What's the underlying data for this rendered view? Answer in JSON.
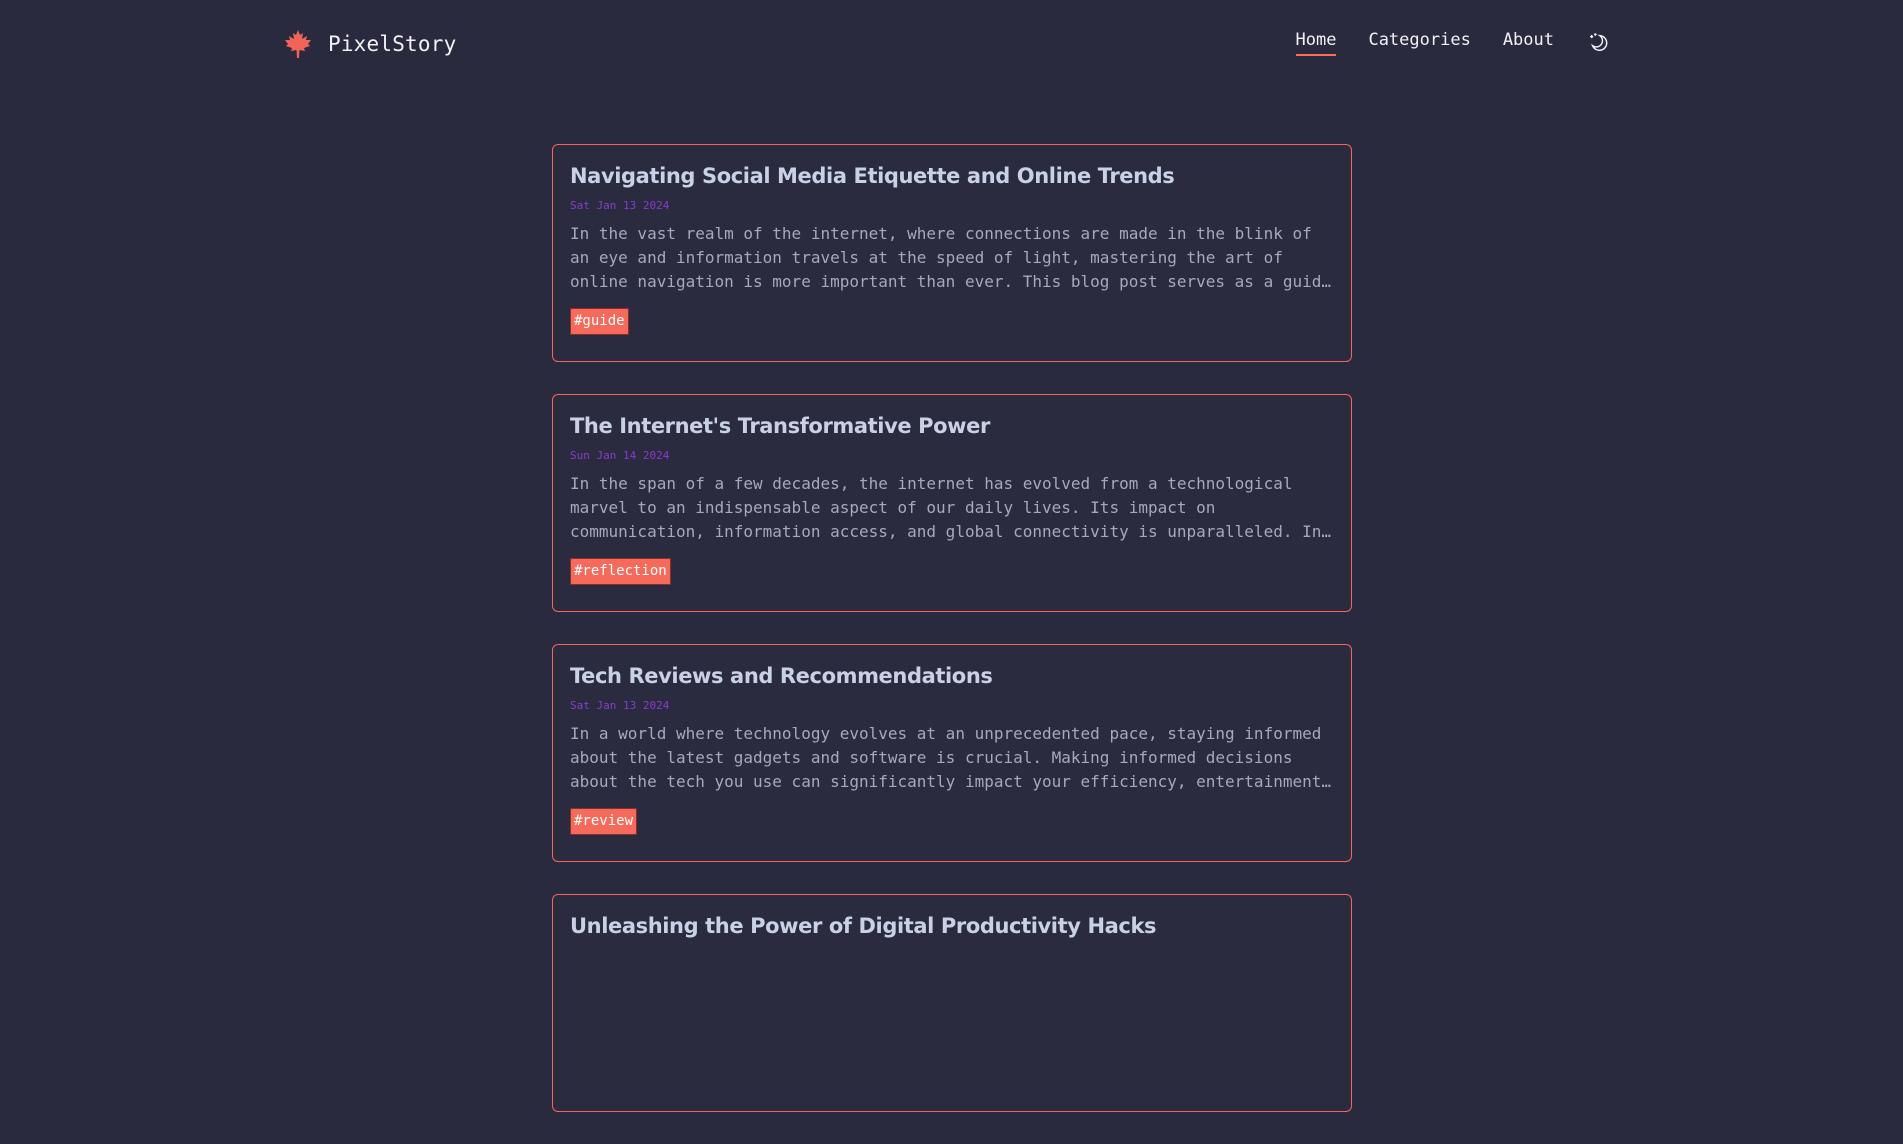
{
  "site": {
    "name": "PixelStory",
    "logo_icon": "maple-leaf-icon",
    "accent_color": "#ff6b55"
  },
  "nav": {
    "items": [
      {
        "label": "Home",
        "active": true
      },
      {
        "label": "Categories",
        "active": false
      },
      {
        "label": "About",
        "active": false
      }
    ],
    "theme_toggle_icon": "theme-toggle-icon"
  },
  "posts": [
    {
      "title": "Navigating Social Media Etiquette and Online Trends",
      "date": "Sat Jan 13 2024",
      "excerpt": "In the vast realm of the internet, where connections are made in the blink of an eye and information travels at the speed of light, mastering the art of online navigation is more important than ever. This blog post serves as a guide to the unwritten rules of the digital world.",
      "tag": "#guide"
    },
    {
      "title": "The Internet's Transformative Power",
      "date": "Sun Jan 14 2024",
      "excerpt": "In the span of a few decades, the internet has evolved from a technological marvel to an indispensable aspect of our daily lives. Its impact on communication, information access, and global connectivity is unparalleled. In this post we reflect on that journey.",
      "tag": "#reflection"
    },
    {
      "title": "Tech Reviews and Recommendations",
      "date": "Sat Jan 13 2024",
      "excerpt": "In a world where technology evolves at an unprecedented pace, staying informed about the latest gadgets and software is crucial. Making informed decisions about the tech you use can significantly impact your efficiency, entertainment and overall experience.",
      "tag": "#review"
    },
    {
      "title": "Unleashing the Power of Digital Productivity Hacks",
      "date": "",
      "excerpt": "",
      "tag": ""
    }
  ]
}
